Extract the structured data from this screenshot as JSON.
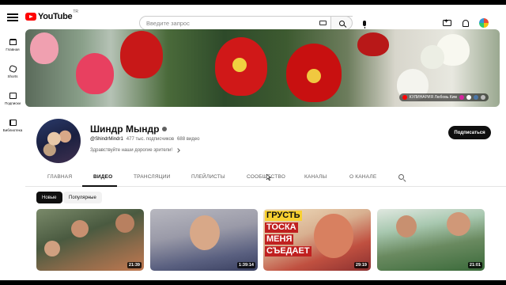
{
  "masthead": {
    "logo_text": "YouTube",
    "logo_region": "TR",
    "search_placeholder": "Введите запрос"
  },
  "guide": {
    "items": [
      {
        "label": "Главная",
        "icon": "home-icon"
      },
      {
        "label": "Shorts",
        "icon": "shorts-icon"
      },
      {
        "label": "Подписки",
        "icon": "subscriptions-icon"
      },
      {
        "label": "Библиотека",
        "icon": "library-icon"
      }
    ]
  },
  "banner": {
    "link_text": "КУЛИНАРИЯ Любовь Ким"
  },
  "channel": {
    "name": "Шиндр Мындр",
    "handle": "@ShindrMindr1",
    "subscribers": "477 тыс. подписчиков",
    "videos_count": "688 видео",
    "description": "Здравствуйте наши дорогие зрители!",
    "subscribe_label": "Подписаться"
  },
  "tabs": [
    {
      "label": "ГЛАВНАЯ",
      "active": false
    },
    {
      "label": "ВИДЕО",
      "active": true
    },
    {
      "label": "ТРАНСЛЯЦИИ",
      "active": false
    },
    {
      "label": "ПЛЕЙЛИСТЫ",
      "active": false
    },
    {
      "label": "СООБЩЕСТВО",
      "active": false
    },
    {
      "label": "КАНАЛЫ",
      "active": false
    },
    {
      "label": "О КАНАЛЕ",
      "active": false
    }
  ],
  "chips": [
    {
      "label": "Новые",
      "selected": true
    },
    {
      "label": "Популярные",
      "selected": false
    }
  ],
  "videos": [
    {
      "duration": "21:39"
    },
    {
      "duration": "1:39:14"
    },
    {
      "duration": "29:19",
      "thumb_text": [
        "ГРУСТЬ",
        "ТОСКА",
        "МЕНЯ",
        "СЪЕДАЕТ"
      ]
    },
    {
      "duration": "21:01"
    }
  ],
  "colors": {
    "brand_red": "#ff0000",
    "text_primary": "#0f0f0f",
    "text_secondary": "#606060",
    "subscribe_bg": "#0f0f0f"
  }
}
